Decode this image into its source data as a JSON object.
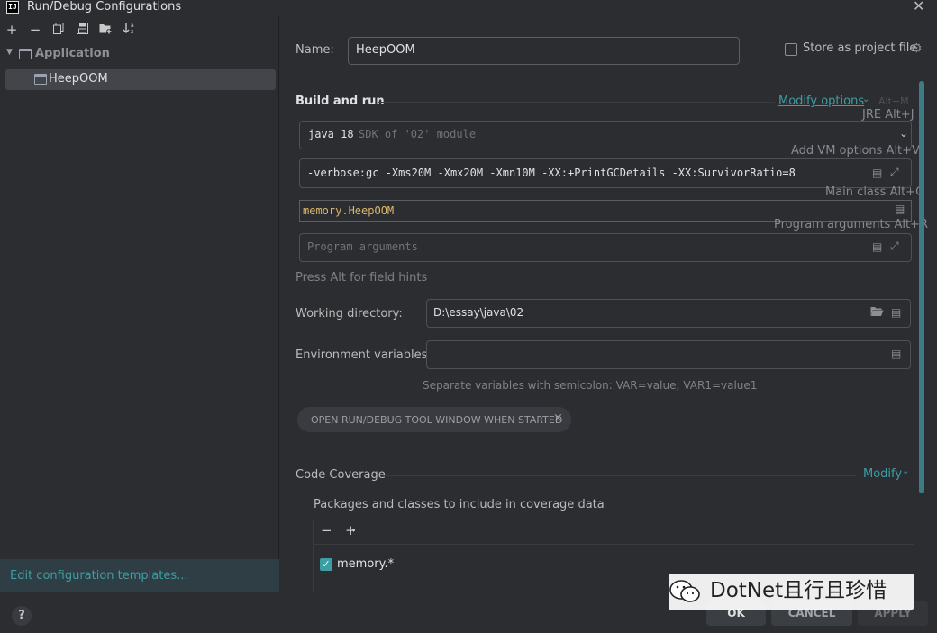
{
  "window": {
    "title": "Run/Debug Configurations",
    "logo": "IJ"
  },
  "left": {
    "toolbar_icons": [
      "add-icon",
      "remove-icon",
      "copy-icon",
      "save-icon",
      "new-folder-icon",
      "sort-icon"
    ],
    "tree": {
      "group_label": "Application",
      "selected_item": "HeepOOM"
    },
    "edit_templates": "Edit configuration templates...",
    "help": "?"
  },
  "form": {
    "name_label": "Name:",
    "name_value": "HeepOOM",
    "store_label": "Store as project file",
    "build_run_label": "Build and run",
    "modify_options": "Modify options",
    "modify_options_shortcut": "Alt+M",
    "jre_hint": "JRE Alt+J",
    "jre_value": "java 18",
    "jre_sub": "SDK of '02' module",
    "vm_hint": "Add VM options Alt+V",
    "vm_value": "-verbose:gc -Xms20M -Xmx20M -Xmn10M -XX:+PrintGCDetails -XX:SurvivorRatio=8",
    "main_class_hint": "Main class Alt+C",
    "main_class_value": "memory.HeepOOM",
    "program_args_hint": "Program arguments Alt+R",
    "program_args_placeholder": "Program arguments",
    "press_alt": "Press Alt for field hints",
    "workdir_label": "Working directory:",
    "workdir_value": "D:\\essay\\java\\02",
    "env_label": "Environment variables:",
    "env_value": "",
    "env_hint": "Separate variables with semicolon: VAR=value; VAR1=value1",
    "open_tool_window": "OPEN RUN/DEBUG TOOL WINDOW WHEN STARTED",
    "open_tool_window_close": "×",
    "coverage_label": "Code Coverage",
    "coverage_modify": "Modify",
    "packages_label": "Packages and classes to include in coverage data",
    "package_entry": "memory.*",
    "package_checked": true
  },
  "buttons": {
    "ok": "OK",
    "cancel": "CANCEL",
    "apply": "APPLY"
  },
  "watermark": "DotNet且行且珍惜",
  "colors": {
    "accent": "#3d9ea3",
    "background": "#2b2d30",
    "class_name": "#d9b86c"
  }
}
